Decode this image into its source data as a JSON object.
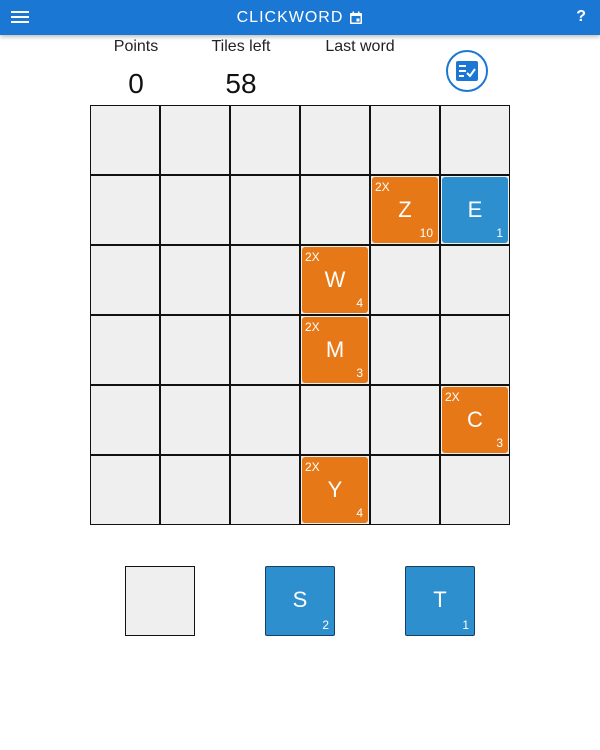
{
  "app": {
    "title": "CLICKWORD",
    "menu_icon": "hamburger-menu-icon",
    "calendar_icon": "calendar-icon",
    "help_label": "?"
  },
  "stats": {
    "points_label": "Points",
    "points_value": "0",
    "tiles_label": "Tiles left",
    "tiles_value": "58",
    "last_word_label": "Last word",
    "last_word_value": ""
  },
  "check_button_icon": "word-check-list-icon",
  "colors": {
    "header": "#1a78d4",
    "orange_tile": "#e67817",
    "blue_tile": "#2e8fcf",
    "empty_cell": "#efefef"
  },
  "board": {
    "rows": 6,
    "cols": 6,
    "tiles": [
      {
        "row": 1,
        "col": 4,
        "letter": "Z",
        "points": "10",
        "mult": "2X",
        "color": "orange"
      },
      {
        "row": 1,
        "col": 5,
        "letter": "E",
        "points": "1",
        "mult": "",
        "color": "blue"
      },
      {
        "row": 2,
        "col": 3,
        "letter": "W",
        "points": "4",
        "mult": "2X",
        "color": "orange"
      },
      {
        "row": 3,
        "col": 3,
        "letter": "M",
        "points": "3",
        "mult": "2X",
        "color": "orange"
      },
      {
        "row": 4,
        "col": 5,
        "letter": "C",
        "points": "3",
        "mult": "2X",
        "color": "orange"
      },
      {
        "row": 5,
        "col": 3,
        "letter": "Y",
        "points": "4",
        "mult": "2X",
        "color": "orange"
      }
    ]
  },
  "rack": [
    {
      "letter": "",
      "points": "",
      "empty": true
    },
    {
      "letter": "S",
      "points": "2",
      "empty": false
    },
    {
      "letter": "T",
      "points": "1",
      "empty": false
    }
  ]
}
